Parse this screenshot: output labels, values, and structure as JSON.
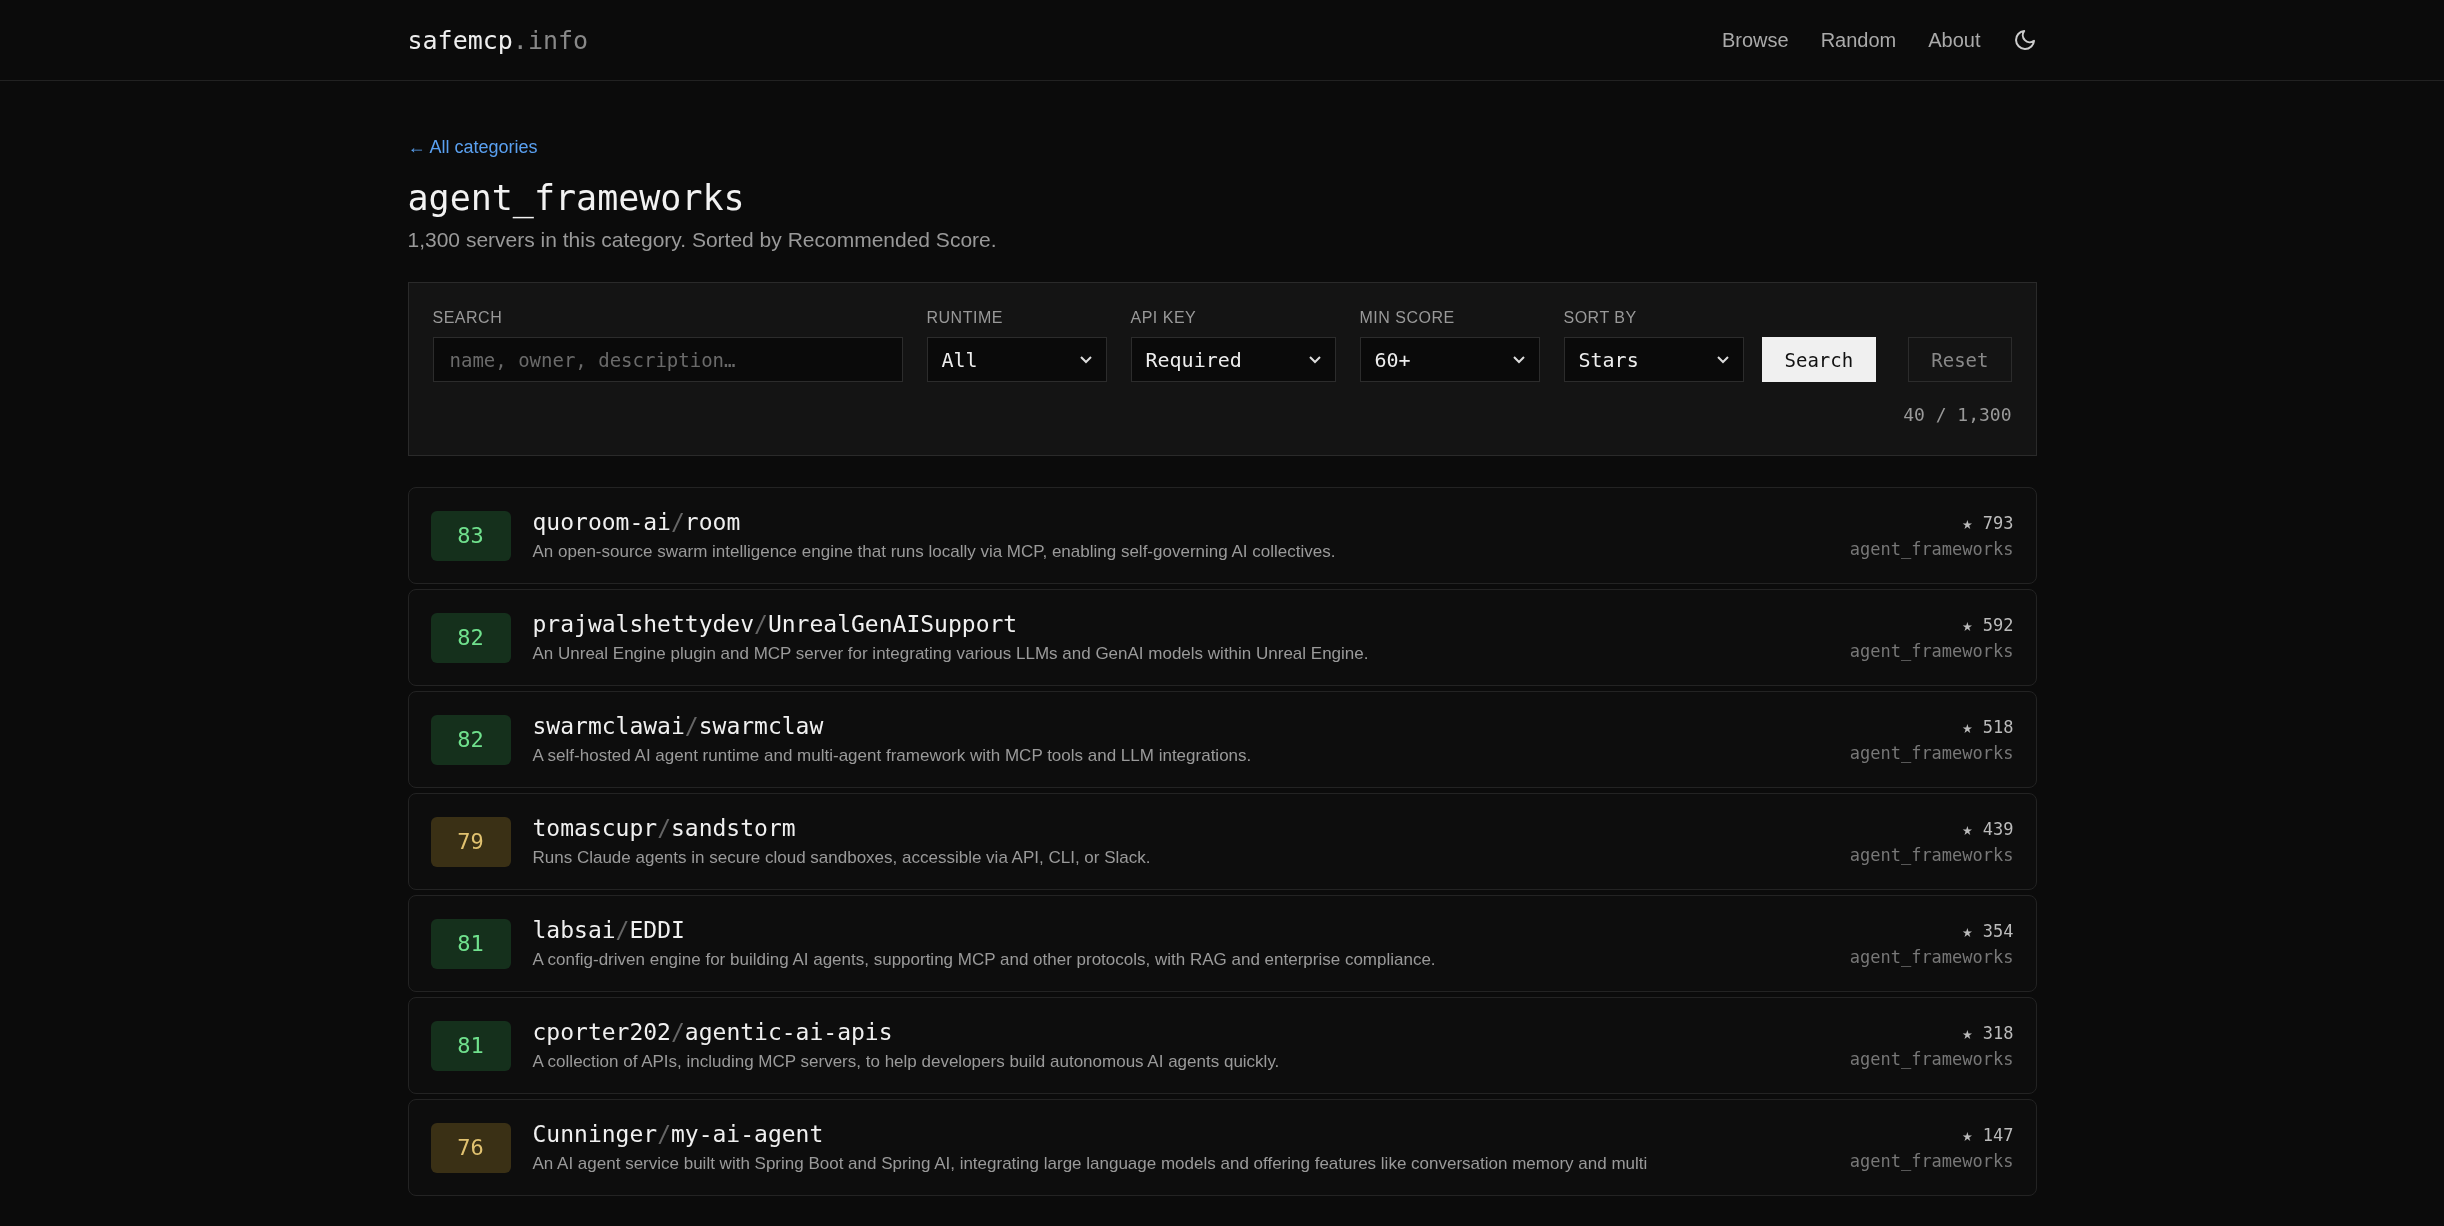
{
  "header": {
    "logo_main": "safemcp",
    "logo_suffix": ".info",
    "nav": [
      "Browse",
      "Random",
      "About"
    ]
  },
  "back_link": "← All categories",
  "title": "agent_frameworks",
  "subtitle": "1,300 servers in this category. Sorted by Recommended Score.",
  "filters": {
    "search": {
      "label": "SEARCH",
      "placeholder": "name, owner, description…"
    },
    "selects": [
      {
        "label": "RUNTIME",
        "value": "All"
      },
      {
        "label": "API KEY",
        "value": "Required"
      },
      {
        "label": "MIN SCORE",
        "value": "60+"
      },
      {
        "label": "SORT BY",
        "value": "Stars"
      }
    ],
    "search_button": "Search",
    "reset_button": "Reset",
    "result_count": "40 / 1,300"
  },
  "servers": [
    {
      "score": "83",
      "color": "#15301c",
      "owner": "quoroom-ai",
      "separator": "/",
      "repo": "room",
      "description": "An open-source swarm intelligence engine that runs locally via MCP, enabling self-governing AI collectives.",
      "star_count": "★ 793",
      "category": "agent_frameworks"
    },
    {
      "score": "82",
      "color": "#15301c",
      "owner": "prajwalshettydev",
      "separator": "/",
      "repo": "UnrealGenAISupport",
      "description": "An Unreal Engine plugin and MCP server for integrating various LLMs and GenAI models within Unreal Engine.",
      "star_count": "★ 592",
      "category": "agent_frameworks"
    },
    {
      "score": "82",
      "color": "#15301c",
      "owner": "swarmclawai",
      "separator": "/",
      "repo": "swarmclaw",
      "description": "A self-hosted AI agent runtime and multi-agent framework with MCP tools and LLM integrations.",
      "star_count": "★ 518",
      "category": "agent_frameworks"
    },
    {
      "score": "79",
      "color": "#3a3015",
      "owner": "tomascupr",
      "separator": "/",
      "repo": "sandstorm",
      "description": "Runs Claude agents in secure cloud sandboxes, accessible via API, CLI, or Slack.",
      "star_count": "★ 439",
      "category": "agent_frameworks"
    },
    {
      "score": "81",
      "color": "#15301c",
      "owner": "labsai",
      "separator": "/",
      "repo": "EDDI",
      "description": "A config-driven engine for building AI agents, supporting MCP and other protocols, with RAG and enterprise compliance.",
      "star_count": "★ 354",
      "category": "agent_frameworks"
    },
    {
      "score": "81",
      "color": "#15301c",
      "owner": "cporter202",
      "separator": "/",
      "repo": "agentic-ai-apis",
      "description": "A collection of APIs, including MCP servers, to help developers build autonomous AI agents quickly.",
      "star_count": "★ 318",
      "category": "agent_frameworks"
    },
    {
      "score": "76",
      "color": "#3a3015",
      "owner": "Cunninger",
      "separator": "/",
      "repo": "my-ai-agent",
      "description": "An AI agent service built with Spring Boot and Spring AI, integrating large language models and offering features like conversation memory and multi",
      "star_count": "★ 147",
      "category": "agent_frameworks"
    }
  ]
}
